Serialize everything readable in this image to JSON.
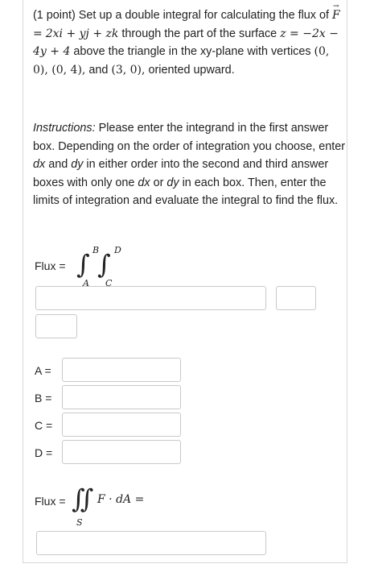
{
  "problem": {
    "points": "(1 point)",
    "intro_a": "Set up a double integral for calculating the flux of",
    "field_F": "F",
    "eq": "=",
    "field_expr": "2xi + yj + zk",
    "through": "through the part of the surface",
    "surface_expr": "z = −2x − 4y + 4",
    "above": "above the triangle in the xy-plane with vertices",
    "vertices": "(0, 0), (0, 4),",
    "and": "and",
    "vertex3": "(3, 0),",
    "oriented": "oriented upward."
  },
  "instructions": {
    "label": "Instructions:",
    "text": "Please enter the integrand in the first answer box. Depending on the order of integration you choose, enter",
    "dx1": "dx",
    "and": "and",
    "dy1": "dy",
    "text2": "in either order into the second and third answer boxes with only one",
    "dx2": "dx",
    "or": "or",
    "dy2": "dy",
    "text3": "in each box. Then, enter the limits of integration and evaluate the integral to find the flux."
  },
  "flux_setup": {
    "label": "Flux =",
    "upper_outer": "B",
    "lower_outer": "A",
    "upper_inner": "D",
    "lower_inner": "C"
  },
  "limits": [
    {
      "label": "A ="
    },
    {
      "label": "B ="
    },
    {
      "label": "C ="
    },
    {
      "label": "D ="
    }
  ],
  "flux_result": {
    "label": "Flux =",
    "integrand": "F · dA =",
    "region": "S"
  }
}
